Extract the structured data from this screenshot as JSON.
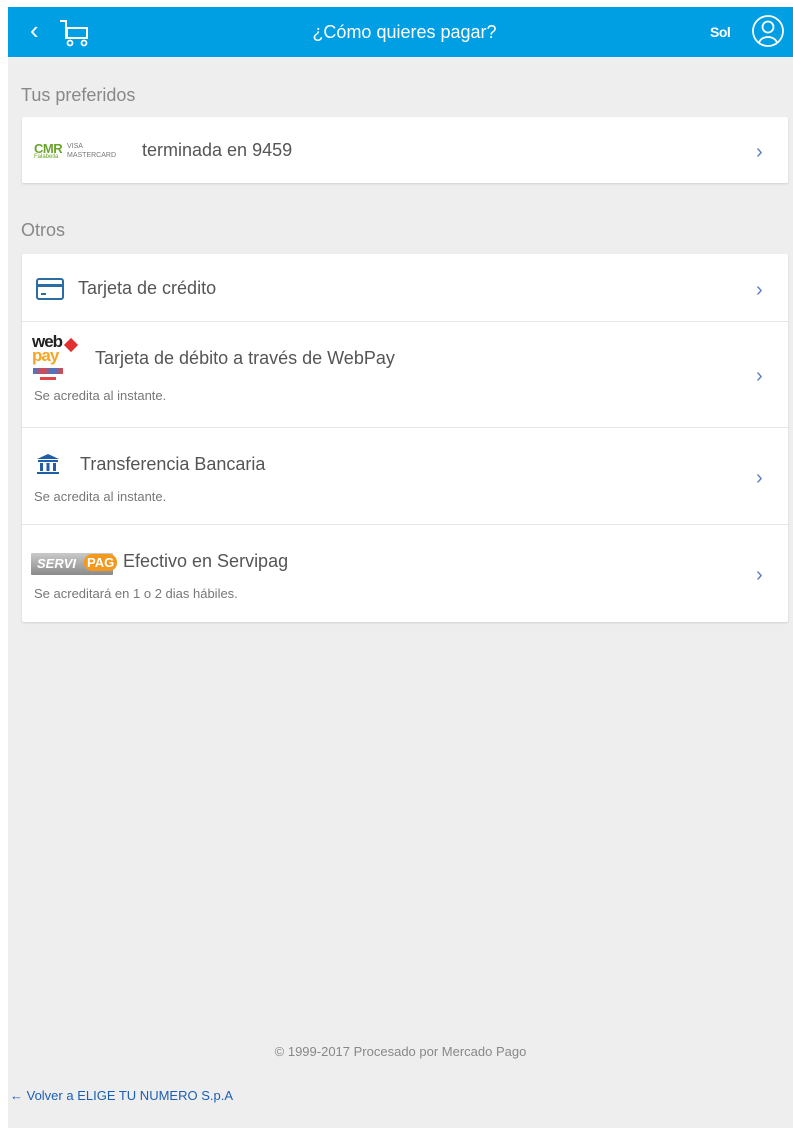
{
  "header": {
    "back_glyph": "‹",
    "title": "¿Cómo quieres pagar?",
    "user_name": "Sol"
  },
  "preferred": {
    "section_title": "Tus preferidos",
    "card": {
      "logo_cmr": "CMR",
      "logo_falabella": "Falabella",
      "logo_visa": "VISA",
      "logo_mastercard": "MASTERCARD",
      "label": "terminada en 9459"
    }
  },
  "others": {
    "section_title": "Otros",
    "items": [
      {
        "label": "Tarjeta de crédito",
        "sub": ""
      },
      {
        "label": "Tarjeta de débito a través de WebPay",
        "sub": "Se acredita al instante.",
        "logo_web": "web",
        "logo_pay": "pay"
      },
      {
        "label": "Transferencia Bancaria",
        "sub": "Se acredita al instante."
      },
      {
        "label": "Efectivo en Servipag",
        "sub": "Se acreditará en 1 o 2 dias hábiles.",
        "logo_servi": "SERVI",
        "logo_pag": "PAG"
      }
    ]
  },
  "chevron_glyph": "›",
  "footer": {
    "copyright": "© 1999-2017 Procesado por Mercado Pago",
    "back_link": "← Volver a ELIGE TU NUMERO S.p.A"
  },
  "colors": {
    "header_bg": "#009ee3",
    "page_bg": "#eeeeee",
    "accent_link": "#1a5fb4",
    "chevron": "#5b7fc0"
  }
}
